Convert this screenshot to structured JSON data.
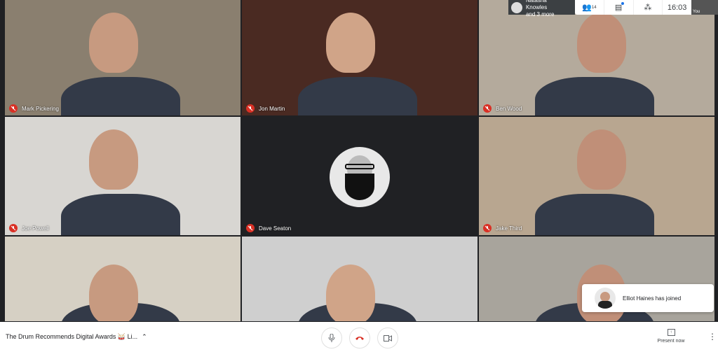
{
  "participants": [
    {
      "name": "Mark Pickering",
      "bg": "#8a7f6f",
      "muted": true
    },
    {
      "name": "Jon Martin",
      "bg": "#4a2a22",
      "muted": true
    },
    {
      "name": "Ben Wood",
      "bg": "#b4aa9c",
      "muted": true
    },
    {
      "name": "Joe Powell",
      "bg": "#d8d6d2",
      "muted": true
    },
    {
      "name": "Dave Seaton",
      "bg": "#202124",
      "muted": true,
      "avatar": "bearded-avatar"
    },
    {
      "name": "Jake Third",
      "bg": "#b8a690",
      "muted": true
    },
    {
      "name": "",
      "bg": "#d6d0c4"
    },
    {
      "name": "",
      "bg": "#cfcfcf"
    },
    {
      "name": "",
      "bg": "#a8a49c"
    }
  ],
  "topbar": {
    "pinned_name": "Natasha Knowles",
    "pinned_more": "and 3 more",
    "participant_count": "14",
    "time": "16:03",
    "self_label": "You"
  },
  "bottom": {
    "meeting_title": "The Drum Recommends Digital Awards 🥁 Li...",
    "present_label": "Present now"
  },
  "toast": {
    "message": "Elliot Haines has joined"
  },
  "colors": {
    "danger": "#d93025",
    "accent": "#1a73e8"
  }
}
